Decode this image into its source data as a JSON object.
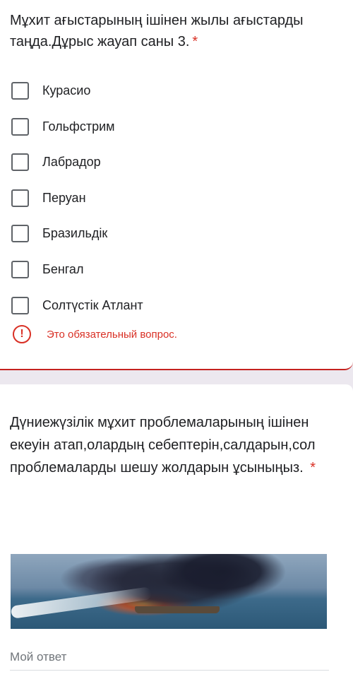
{
  "question1": {
    "title": "Мұхит ағыстарының ішінен жылы ағыстарды таңда.Дұрыс жауап саны 3.",
    "required_mark": "*",
    "options": [
      {
        "label": "Курасио",
        "checked": false
      },
      {
        "label": "Гольфстрим",
        "checked": false
      },
      {
        "label": "Лабрадор",
        "checked": false
      },
      {
        "label": "Перуан",
        "checked": false
      },
      {
        "label": "Бразильдік",
        "checked": false
      },
      {
        "label": "Бенгал",
        "checked": false
      },
      {
        "label": "Солтүстік Атлант",
        "checked": false
      }
    ],
    "error": {
      "icon": "!",
      "text": "Это обязательный вопрос."
    }
  },
  "question2": {
    "title": "Дүниежүзілік мұхит проблемаларының ішінен екеуін атап,олардың себептерін,салдарын,сол проблемаларды шешу жолдарын ұсыныңыз.",
    "required_mark": "*",
    "answer_placeholder": "Мой ответ"
  },
  "colors": {
    "error": "#d93025",
    "checkbox_border": "#5f6368",
    "page_bg": "#ece8ef"
  }
}
